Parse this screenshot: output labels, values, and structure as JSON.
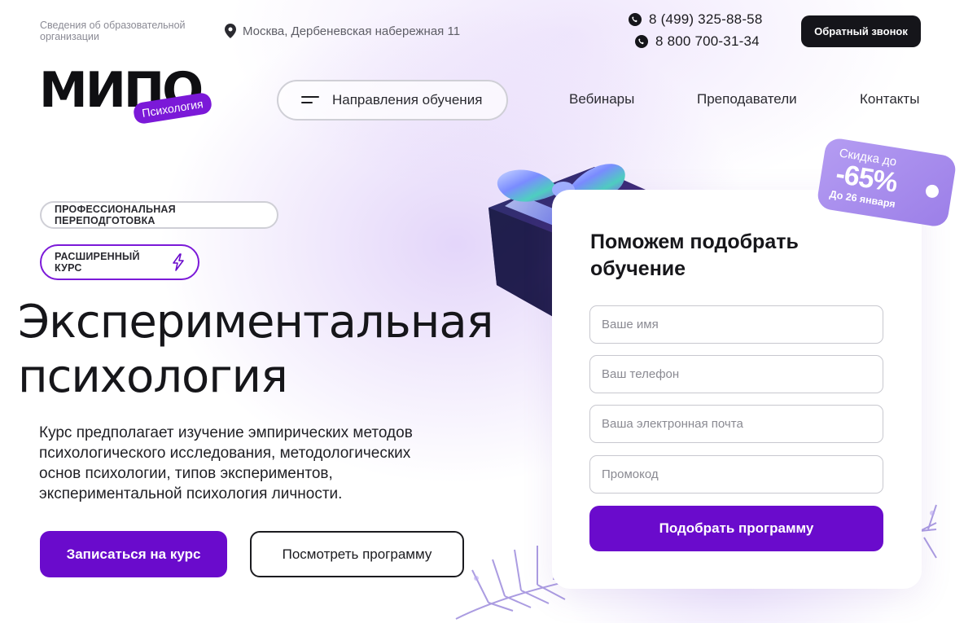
{
  "header": {
    "org_info_link": "Сведения об образовательной организации",
    "address": "Москва, Дербеневская набережная 11",
    "phones": [
      "8 (499) 325-88-58",
      "8 800 700-31-34"
    ],
    "callback_label": "Обратный звонок"
  },
  "logo": {
    "word": "МИПО",
    "badge": "Психология"
  },
  "nav": {
    "directions_label": "Направления обучения",
    "links": [
      "Вебинары",
      "Преподаватели",
      "Контакты"
    ]
  },
  "hero": {
    "tag_retraining": "ПРОФЕССИОНАЛЬНАЯ ПЕРЕПОДГОТОВКА",
    "tag_extended": "РАСШИРЕННЫЙ КУРС",
    "title_line1": "Экспериментальная",
    "title_line2": "психология",
    "description": "Курс предполагает изучение эмпирических методов психологического исследования, методологических основ психологии, типов экспериментов, экспериментальной психология личности.",
    "enroll_label": "Записаться на курс",
    "program_label": "Посмотреть программу"
  },
  "form": {
    "title": "Поможем подобрать обучение",
    "name_placeholder": "Ваше имя",
    "phone_placeholder": "Ваш телефон",
    "email_placeholder": "Ваша электронная почта",
    "promo_placeholder": "Промокод",
    "submit_label": "Подобрать программу"
  },
  "discount": {
    "top": "Скидка до",
    "value": "-65%",
    "until": "До 26 января"
  },
  "colors": {
    "accent": "#6a0bcc",
    "dark_button": "#15151a",
    "discount_tag": "#a88cee"
  },
  "icons": [
    "map-pin-icon",
    "phone-icon",
    "burger-menu-icon",
    "lightning-bolt-icon"
  ]
}
